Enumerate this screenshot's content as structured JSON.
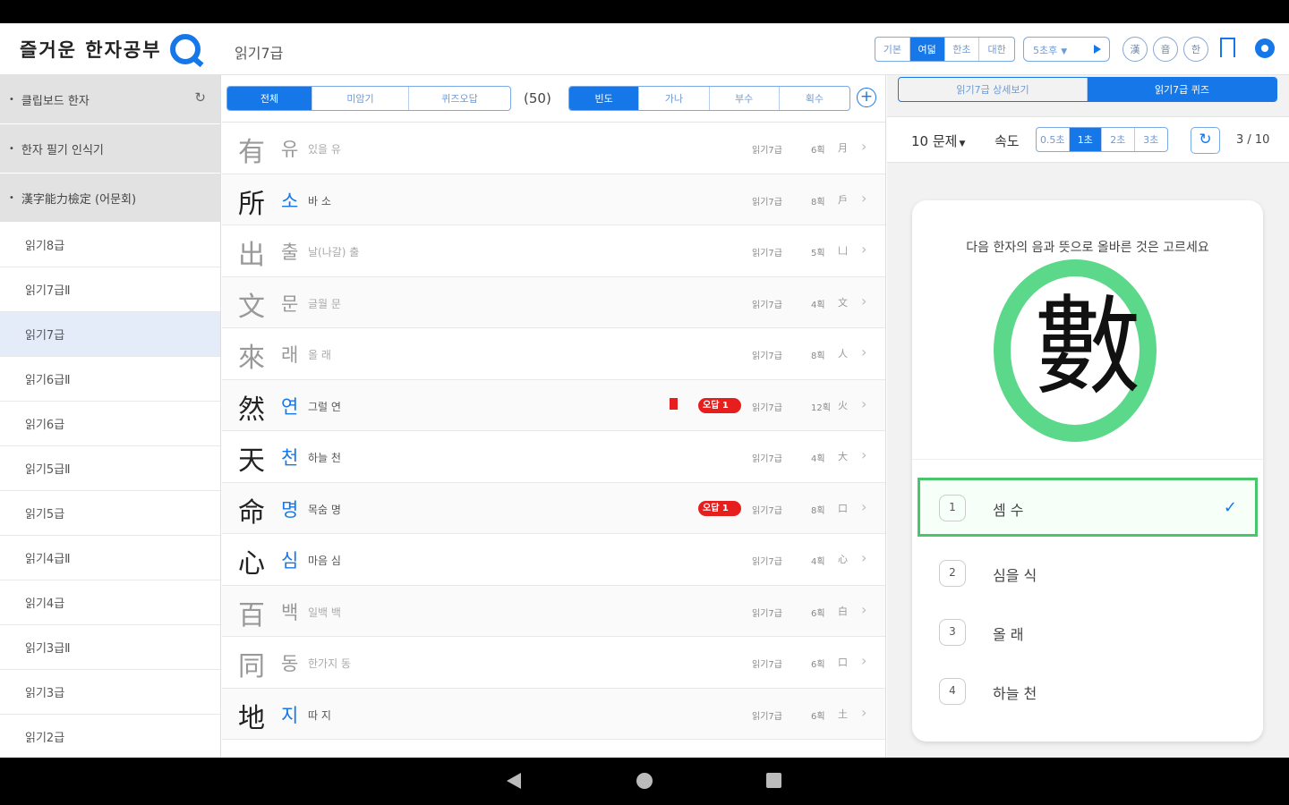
{
  "header": {
    "app_title": "즐거운 한자공부",
    "page_label": "읽기7급",
    "font_modes": [
      "기본",
      "여덟",
      "한초",
      "대한"
    ],
    "font_selected": 1,
    "speed_select": "5초후",
    "circle_buttons": [
      "漢",
      "音",
      "한"
    ]
  },
  "sidebar": {
    "categories": [
      {
        "label": "클립보드 한자",
        "refresh": "↻"
      },
      {
        "label": "한자 필기 인식기",
        "refresh": ""
      },
      {
        "label": "漢字能力檢定 (어문회)",
        "refresh": ""
      }
    ],
    "items": [
      "읽기8급",
      "읽기7급Ⅱ",
      "읽기7급",
      "읽기6급Ⅱ",
      "읽기6급",
      "읽기5급Ⅱ",
      "읽기5급",
      "읽기4급Ⅱ",
      "읽기4급",
      "읽기3급Ⅱ",
      "읽기3급",
      "읽기2급"
    ],
    "selected_index": 2
  },
  "filters": {
    "tabs": [
      "전체",
      "미암기",
      "퀴즈오답"
    ],
    "selected_tab": 0,
    "count": "(50)",
    "sort": [
      "빈도",
      "가나",
      "부수",
      "획수"
    ],
    "selected_sort": 0,
    "add": "+"
  },
  "rows": [
    {
      "hanja": "有",
      "reading": "유",
      "meaning": "있을 유",
      "level": "읽기7급",
      "strokes": "6획",
      "radical": "月",
      "dim": true,
      "bookmark": false,
      "wrong": false
    },
    {
      "hanja": "所",
      "reading": "소",
      "meaning": "바 소",
      "level": "읽기7급",
      "strokes": "8획",
      "radical": "戶",
      "dim": false,
      "bookmark": false,
      "wrong": false
    },
    {
      "hanja": "出",
      "reading": "출",
      "meaning": "날(나갈) 출",
      "level": "읽기7급",
      "strokes": "5획",
      "radical": "凵",
      "dim": true,
      "bookmark": false,
      "wrong": false
    },
    {
      "hanja": "文",
      "reading": "문",
      "meaning": "글월 문",
      "level": "읽기7급",
      "strokes": "4획",
      "radical": "文",
      "dim": true,
      "bookmark": false,
      "wrong": false
    },
    {
      "hanja": "來",
      "reading": "래",
      "meaning": "올 래",
      "level": "읽기7급",
      "strokes": "8획",
      "radical": "人",
      "dim": true,
      "bookmark": false,
      "wrong": false
    },
    {
      "hanja": "然",
      "reading": "연",
      "meaning": "그럴 연",
      "level": "읽기7급",
      "strokes": "12획",
      "radical": "火",
      "dim": false,
      "bookmark": true,
      "wrong": true
    },
    {
      "hanja": "天",
      "reading": "천",
      "meaning": "하늘 천",
      "level": "읽기7급",
      "strokes": "4획",
      "radical": "大",
      "dim": false,
      "bookmark": false,
      "wrong": false
    },
    {
      "hanja": "命",
      "reading": "명",
      "meaning": "목숨 명",
      "level": "읽기7급",
      "strokes": "8획",
      "radical": "口",
      "dim": false,
      "bookmark": false,
      "wrong": true
    },
    {
      "hanja": "心",
      "reading": "심",
      "meaning": "마음 심",
      "level": "읽기7급",
      "strokes": "4획",
      "radical": "心",
      "dim": false,
      "bookmark": false,
      "wrong": false
    },
    {
      "hanja": "百",
      "reading": "백",
      "meaning": "일백 백",
      "level": "읽기7급",
      "strokes": "6획",
      "radical": "白",
      "dim": true,
      "bookmark": false,
      "wrong": false
    },
    {
      "hanja": "同",
      "reading": "동",
      "meaning": "한가지 동",
      "level": "읽기7급",
      "strokes": "6획",
      "radical": "口",
      "dim": true,
      "bookmark": false,
      "wrong": false
    },
    {
      "hanja": "地",
      "reading": "지",
      "meaning": "따 지",
      "level": "읽기7급",
      "strokes": "6획",
      "radical": "土",
      "dim": false,
      "bookmark": false,
      "wrong": false
    }
  ],
  "wrong_badge": "오답 1",
  "quiz": {
    "tabs": [
      "읽기7급 상세보기",
      "읽기7급 퀴즈"
    ],
    "selected_tab": 1,
    "question_count": "10 문제",
    "speed_label": "속도",
    "speeds": [
      "0.5초",
      "1초",
      "2초",
      "3초"
    ],
    "selected_speed": 1,
    "retry": "↻",
    "progress": "3 / 10",
    "question": "다음 한자의 음과 뜻으로 올바른 것은 고르세요",
    "hanja": "數",
    "options": [
      {
        "num": "1",
        "text": "셈 수",
        "correct": true
      },
      {
        "num": "2",
        "text": "심을 식",
        "correct": false
      },
      {
        "num": "3",
        "text": "올 래",
        "correct": false
      },
      {
        "num": "4",
        "text": "하늘 천",
        "correct": false
      }
    ],
    "check": "✓"
  },
  "colors": {
    "accent": "#1677e8",
    "correct": "#49c66b",
    "ring": "#5bd88a",
    "wrong": "#e61e1e"
  }
}
